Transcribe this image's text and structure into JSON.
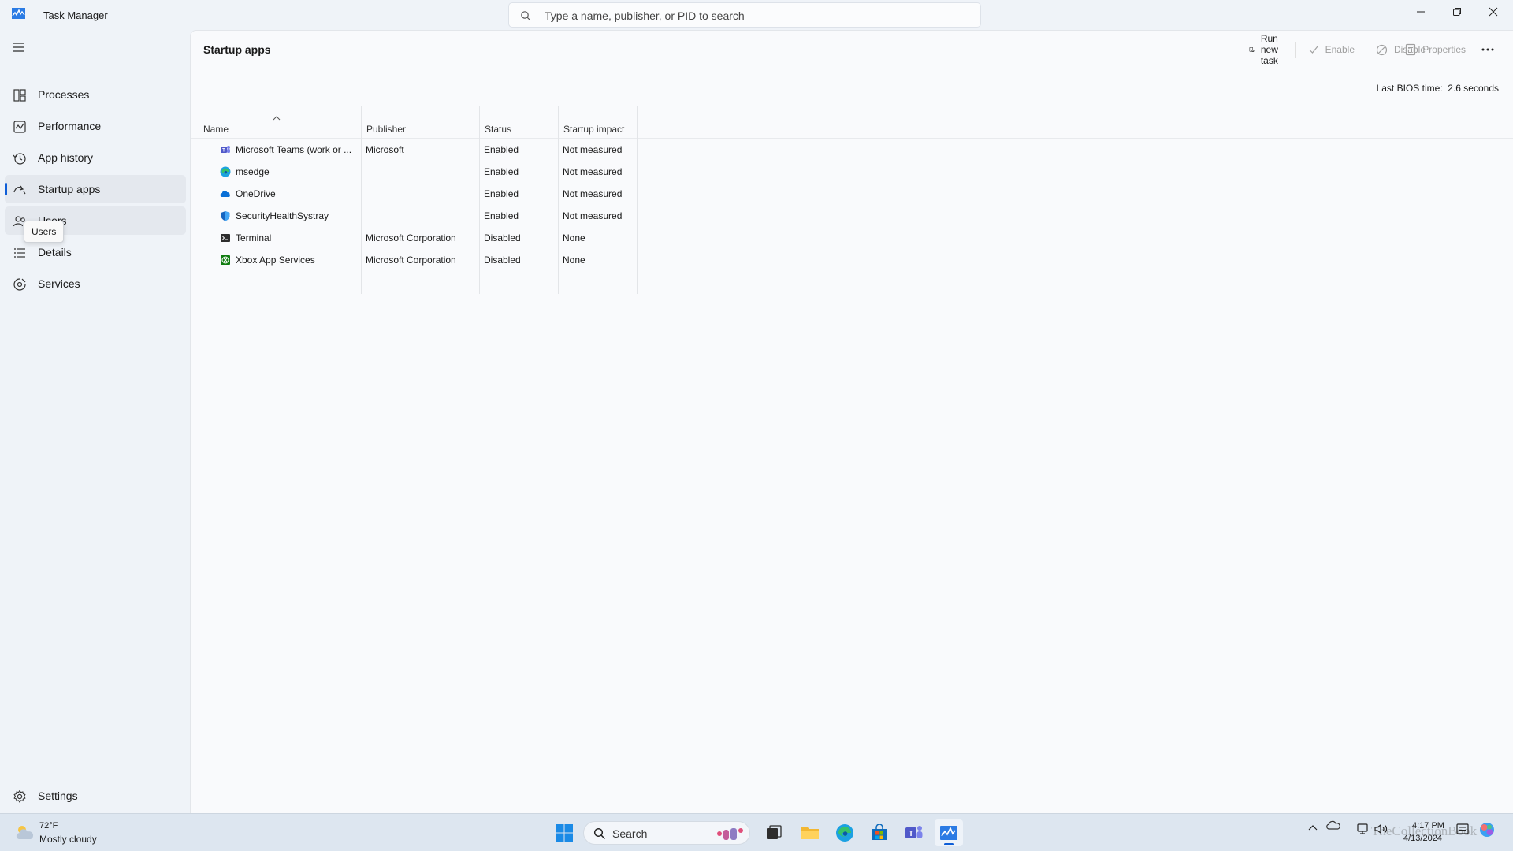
{
  "window": {
    "title": "Task Manager",
    "search_placeholder": "Type a name, publisher, or PID to search"
  },
  "sidebar": {
    "items": [
      {
        "label": "Processes",
        "icon": "processes-icon"
      },
      {
        "label": "Performance",
        "icon": "performance-icon"
      },
      {
        "label": "App history",
        "icon": "app-history-icon"
      },
      {
        "label": "Startup apps",
        "icon": "startup-apps-icon",
        "active": true
      },
      {
        "label": "Users",
        "icon": "users-icon",
        "hovered": true
      },
      {
        "label": "Details",
        "icon": "details-icon"
      },
      {
        "label": "Services",
        "icon": "services-icon"
      }
    ],
    "tooltip": "Users",
    "settings_label": "Settings"
  },
  "main": {
    "title": "Startup apps",
    "commands": {
      "run_new_task": "Run new task",
      "enable": "Enable",
      "disable": "Disable",
      "properties": "Properties"
    },
    "bios_label": "Last BIOS time:",
    "bios_value": "2.6 seconds",
    "columns": [
      "Name",
      "Publisher",
      "Status",
      "Startup impact"
    ],
    "rows": [
      {
        "name": "Microsoft Teams (work or ...",
        "publisher": "Microsoft",
        "status": "Enabled",
        "impact": "Not measured",
        "icon": "teams-icon"
      },
      {
        "name": "msedge",
        "publisher": "",
        "status": "Enabled",
        "impact": "Not measured",
        "icon": "edge-icon"
      },
      {
        "name": "OneDrive",
        "publisher": "",
        "status": "Enabled",
        "impact": "Not measured",
        "icon": "onedrive-icon"
      },
      {
        "name": "SecurityHealthSystray",
        "publisher": "",
        "status": "Enabled",
        "impact": "Not measured",
        "icon": "shield-icon"
      },
      {
        "name": "Terminal",
        "publisher": "Microsoft Corporation",
        "status": "Disabled",
        "impact": "None",
        "icon": "terminal-icon"
      },
      {
        "name": "Xbox App Services",
        "publisher": "Microsoft Corporation",
        "status": "Disabled",
        "impact": "None",
        "icon": "xbox-icon"
      }
    ]
  },
  "taskbar": {
    "weather_temp": "72°F",
    "weather_desc": "Mostly cloudy",
    "search_label": "Search",
    "time": "4:17 PM",
    "date": "4/13/2024",
    "watermark": "TheCollectionBook"
  },
  "colors": {
    "accent": "#0f5ed7",
    "sidebar_bg": "#eff3f8",
    "main_bg": "#f9fafc"
  }
}
